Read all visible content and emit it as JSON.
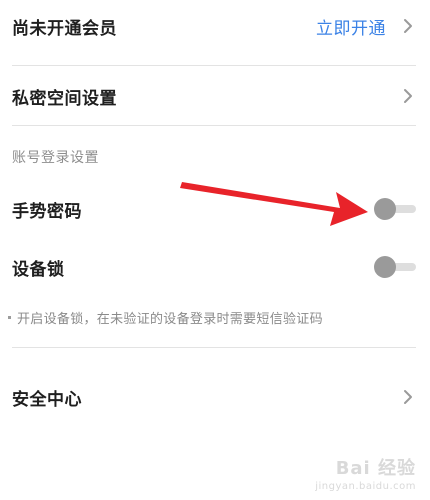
{
  "membership": {
    "label": "尚未开通会员",
    "action": "立即开通"
  },
  "private_space": {
    "label": "私密空间设置"
  },
  "login_settings": {
    "section_title": "账号登录设置",
    "gesture_password": {
      "label": "手势密码",
      "enabled": false
    },
    "device_lock": {
      "label": "设备锁",
      "enabled": false,
      "hint": "开启设备锁，在未验证的设备登录时需要短信验证码"
    }
  },
  "security_center": {
    "label": "安全中心"
  },
  "watermark": {
    "text": "Bai 经验",
    "sub": "jingyan.baidu.com"
  },
  "colors": {
    "accent": "#3b82e6",
    "arrow": "#e8232a",
    "toggle_knob": "#9a9a9a",
    "toggle_track": "#dedede"
  },
  "icons": {
    "chevron": "chevron-right-icon",
    "arrow": "red-arrow-annotation"
  }
}
